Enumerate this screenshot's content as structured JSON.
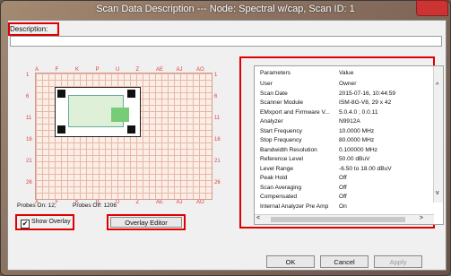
{
  "window": {
    "title": "Scan Data Description --- Node: Spectral w/cap,  Scan ID: 1"
  },
  "description": {
    "label": "Description:",
    "value": ""
  },
  "grid": {
    "col_labels": [
      "A",
      "F",
      "K",
      "P",
      "U",
      "Z",
      "AE",
      "AJ",
      "AO"
    ],
    "row_labels": [
      "1",
      "6",
      "11",
      "16",
      "21",
      "26"
    ],
    "probes_on_label": "Probes On: 12;",
    "probes_off_label": "Probes Off: 1206"
  },
  "show_overlay": {
    "label": "Show Overlay",
    "checked": true
  },
  "buttons": {
    "overlay_editor": "Overlay Editor",
    "ok": "OK",
    "cancel": "Cancel",
    "apply": "Apply"
  },
  "params": {
    "headers": [
      "Parameters",
      "Value"
    ],
    "rows": [
      [
        "User",
        "Owner"
      ],
      [
        "Scan Date",
        "2015-07-16,  10:44:59"
      ],
      [
        "Scanner Module",
        "ISM-8G-V8,  29 x 42"
      ],
      [
        "EMxport and Firmware V...",
        "5.0.4.0 ;  0.0.11"
      ],
      [
        "Analyzer",
        "N9912A"
      ],
      [
        "Start Frequency",
        "10.0000    MHz"
      ],
      [
        "Stop Frequency",
        "80.0000    MHz"
      ],
      [
        "Bandwidth Resolution",
        "0.100000   MHz"
      ],
      [
        "Reference Level",
        "50.00   dBuV"
      ],
      [
        "Level Range",
        "-6.50   to  18.00   dBuV"
      ],
      [
        "Peak Hold",
        "Off"
      ],
      [
        "Scan Averaging",
        "Off"
      ],
      [
        "Compensated",
        "Off"
      ],
      [
        "Internal Analyzer Pre Amp",
        "On"
      ]
    ]
  },
  "colors": {
    "annotation": "#e00000",
    "grid_line": "#e7b8a8"
  }
}
